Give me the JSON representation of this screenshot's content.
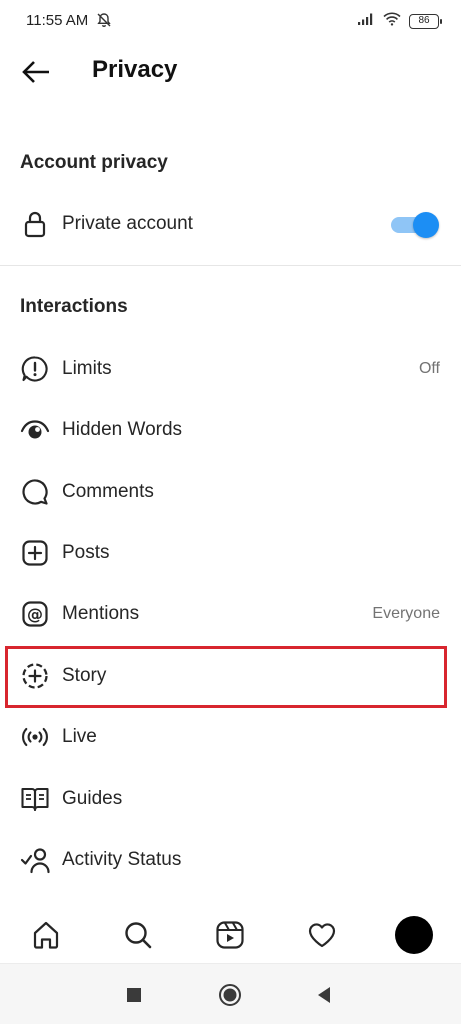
{
  "status_bar": {
    "time": "11:55 AM",
    "battery": "86"
  },
  "header": {
    "title": "Privacy"
  },
  "account_privacy": {
    "section_title": "Account privacy",
    "private_account_label": "Private account",
    "private_account_enabled": true
  },
  "interactions": {
    "section_title": "Interactions",
    "items": [
      {
        "label": "Limits",
        "value": "Off",
        "icon": "limits-icon"
      },
      {
        "label": "Hidden Words",
        "value": "",
        "icon": "eye-icon"
      },
      {
        "label": "Comments",
        "value": "",
        "icon": "comment-icon"
      },
      {
        "label": "Posts",
        "value": "",
        "icon": "plus-square-icon"
      },
      {
        "label": "Mentions",
        "value": "Everyone",
        "icon": "at-icon"
      },
      {
        "label": "Story",
        "value": "",
        "icon": "story-add-icon"
      },
      {
        "label": "Live",
        "value": "",
        "icon": "live-icon"
      },
      {
        "label": "Guides",
        "value": "",
        "icon": "guides-icon"
      },
      {
        "label": "Activity Status",
        "value": "",
        "icon": "activity-status-icon"
      }
    ]
  },
  "colors": {
    "toggle_on": "#1c8ef4",
    "highlight_border": "#d8262f"
  },
  "bottom_nav": [
    "home-icon",
    "search-icon",
    "reels-icon",
    "heart-icon",
    "profile-avatar"
  ],
  "system_nav": [
    "recents-icon",
    "home-circle-icon",
    "back-triangle-icon"
  ]
}
